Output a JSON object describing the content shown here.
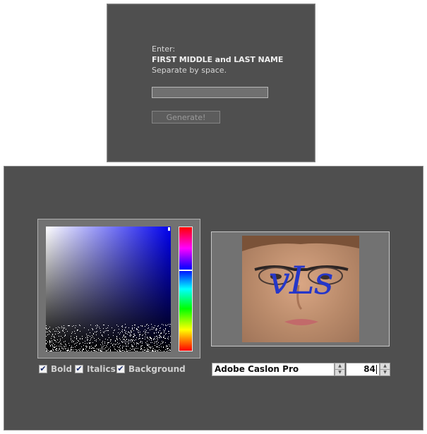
{
  "name_dialog": {
    "enter_label": "Enter:",
    "name_label": "FIRST MIDDLE and LAST NAME",
    "separator_label": "Separate by space.",
    "name_input_value": "",
    "generate_label": "Generate!"
  },
  "color_picker": {
    "selected_color": "#0000ee",
    "hue_colors": [
      "#ff0000",
      "#ff00ff",
      "#0000ff",
      "#00ffff",
      "#00ff00",
      "#ffff00",
      "#ff0000"
    ]
  },
  "options": {
    "bold_label": "Bold",
    "bold_checked": true,
    "italics_label": "Italics",
    "italics_checked": true,
    "background_label": "Background",
    "background_checked": true
  },
  "preview": {
    "text": "vLs",
    "text_color": "#2637c9"
  },
  "font_controls": {
    "font_name": "Adobe Caslon Pro",
    "font_size": "84"
  }
}
